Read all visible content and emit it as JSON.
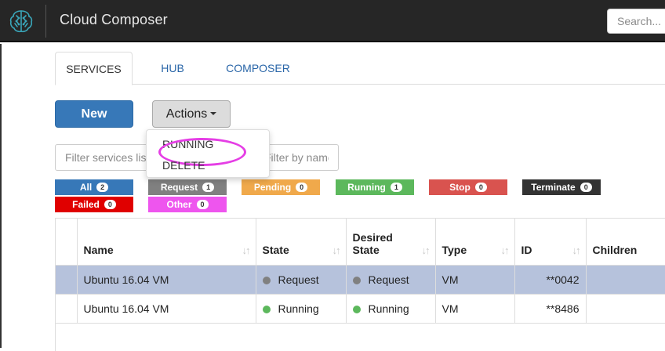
{
  "app": {
    "title": "Cloud Composer",
    "search_placeholder": "Search...",
    "logo_icon": "brain-chip-icon"
  },
  "tabs": [
    {
      "label": "SERVICES",
      "active": true
    },
    {
      "label": "HUB",
      "active": false
    },
    {
      "label": "COMPOSER",
      "active": false
    }
  ],
  "toolbar": {
    "new_label": "New",
    "actions_label": "Actions"
  },
  "filters": {
    "services_placeholder": "Filter services list",
    "name_placeholder": "Filter by name, type ..."
  },
  "actions_menu": {
    "items": [
      "RUNNING",
      "DELETE"
    ],
    "highlighted": "RUNNING",
    "highlight_color": "#e53ee5"
  },
  "status_filters": [
    {
      "label": "All",
      "count": "2",
      "color": "#3778b8"
    },
    {
      "label": "Request",
      "count": "1",
      "color": "#808080"
    },
    {
      "label": "Pending",
      "count": "0",
      "color": "#f0a94b"
    },
    {
      "label": "Running",
      "count": "1",
      "color": "#5cb85c"
    },
    {
      "label": "Stop",
      "count": "0",
      "color": "#d9534f"
    },
    {
      "label": "Terminate",
      "count": "0",
      "color": "#333333"
    },
    {
      "label": "Failed",
      "count": "0",
      "color": "#e00000"
    },
    {
      "label": "Other",
      "count": "0",
      "color": "#ee55ee"
    }
  ],
  "table": {
    "columns": [
      "",
      "Name",
      "State",
      "Desired State",
      "Type",
      "ID",
      "Children"
    ],
    "desired_state_line1": "Desired",
    "desired_state_line2": "State",
    "rows": [
      {
        "name": "Ubuntu 16.04 VM",
        "state": "Request",
        "state_color": "#808080",
        "desired_state": "Request",
        "desired_color": "#808080",
        "type": "VM",
        "id": "**0042",
        "children": "",
        "selected": true
      },
      {
        "name": "Ubuntu 16.04 VM",
        "state": "Running",
        "state_color": "#5cb85c",
        "desired_state": "Running",
        "desired_color": "#5cb85c",
        "type": "VM",
        "id": "**8486",
        "children": "",
        "selected": false
      }
    ]
  }
}
